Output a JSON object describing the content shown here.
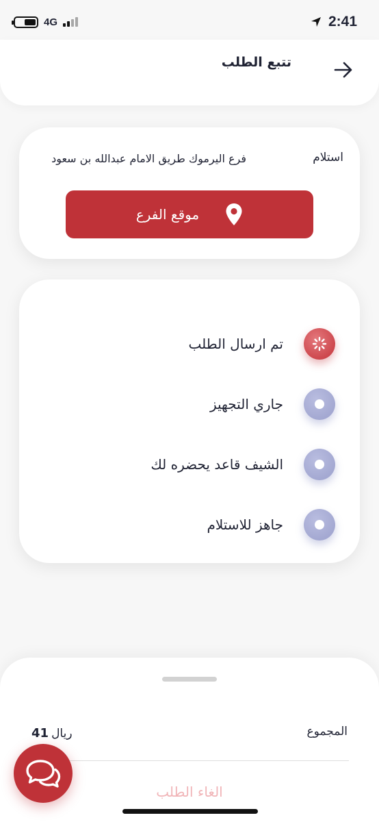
{
  "status_bar": {
    "network": "4G",
    "time": "2:41"
  },
  "header": {
    "title": "تتبع الطلب"
  },
  "pickup": {
    "type_label": "استلام",
    "branch_name": "فرع اليرموك طريق الامام عبدالله بن سعود",
    "location_button_label": "موقع الفرع"
  },
  "order_status": {
    "steps": [
      {
        "label": "تم ارسال الطلب",
        "state": "active"
      },
      {
        "label": "جاري التجهيز",
        "state": "pending"
      },
      {
        "label": "الشيف قاعد يحضره لك",
        "state": "pending"
      },
      {
        "label": "جاهز للاستلام",
        "state": "pending"
      }
    ]
  },
  "summary": {
    "total_label": "المجموع",
    "currency": "ريال",
    "total_amount": "41",
    "cancel_label": "الغاء الطلب"
  },
  "colors": {
    "accent": "#bf3238",
    "pending_dot": "#9ba0cc",
    "cancel_text": "#f1b5b8"
  },
  "icons": {
    "back": "arrow-right-icon",
    "pin": "map-pin-icon",
    "chat": "chat-bubbles-icon"
  }
}
